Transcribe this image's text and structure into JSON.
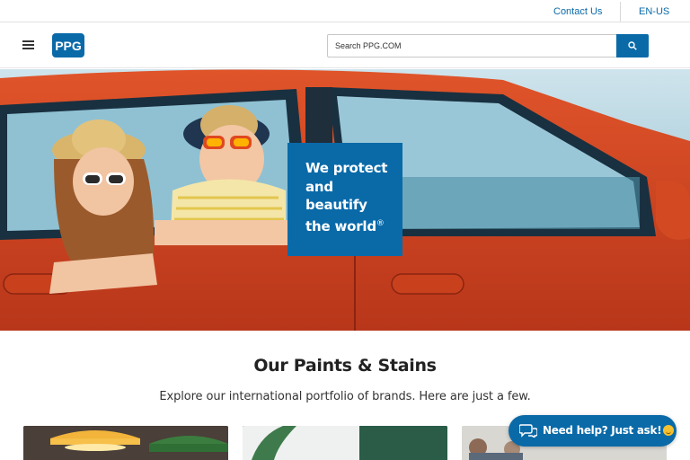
{
  "utility": {
    "contact_label": "Contact Us",
    "language_label": "EN-US"
  },
  "header": {
    "logo_text": "PPG",
    "search": {
      "placeholder": "Search PPG.COM"
    }
  },
  "hero": {
    "tagline_lines": [
      "We protect",
      "and",
      "beautify",
      "the world"
    ],
    "trademark": "®"
  },
  "section": {
    "title": "Our Paints & Stains",
    "subtitle": "Explore our international portfolio of brands. Here are just a few."
  },
  "chat": {
    "label": "Need help? Just ask!"
  },
  "colors": {
    "brand_blue": "#0a6aa8",
    "car_red": "#d8461f"
  },
  "icons": [
    "menu-icon",
    "search-icon",
    "chat-icon"
  ]
}
